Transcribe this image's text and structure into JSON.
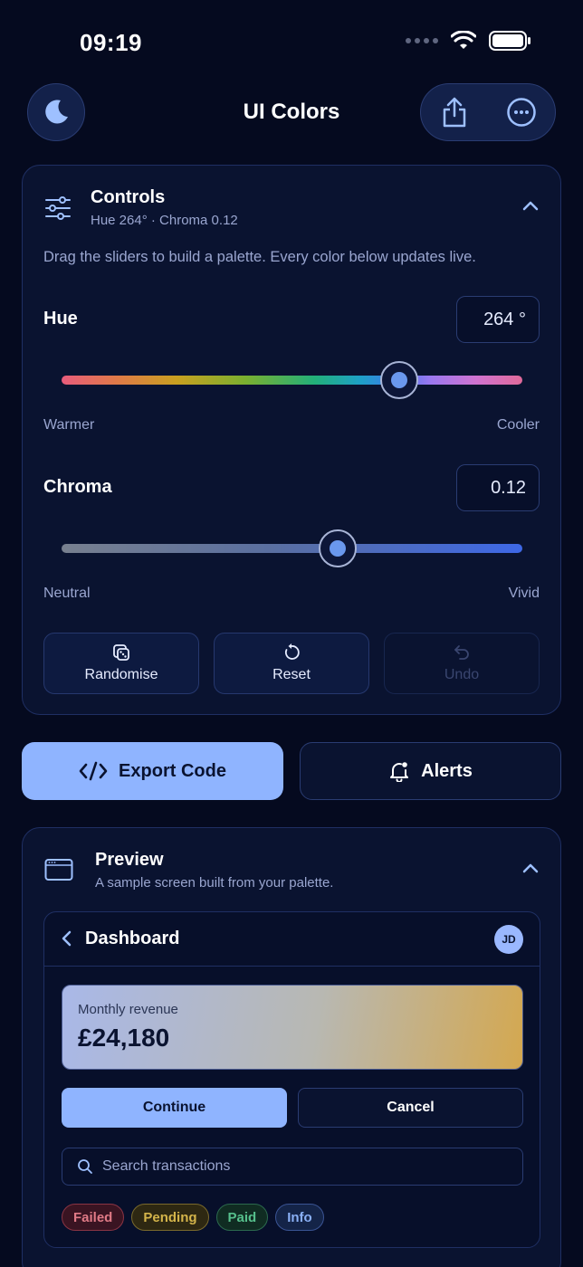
{
  "status_bar": {
    "time": "09:19"
  },
  "nav": {
    "title": "UI Colors"
  },
  "controls": {
    "title": "Controls",
    "subtitle": "Hue 264°  ·  Chroma 0.12",
    "hint": "Drag the sliders to build a palette. Every color below updates live.",
    "hue": {
      "label": "Hue",
      "value": "264 °",
      "numeric": 264,
      "min": 0,
      "max": 360,
      "min_label": "Warmer",
      "max_label": "Cooler"
    },
    "chroma": {
      "label": "Chroma",
      "value": "0.12",
      "numeric": 0.12,
      "min": 0,
      "max": 0.2,
      "min_label": "Neutral",
      "max_label": "Vivid"
    },
    "buttons": {
      "randomise": "Randomise",
      "reset": "Reset",
      "undo": "Undo"
    }
  },
  "actions": {
    "export": "Export Code",
    "alerts": "Alerts"
  },
  "preview": {
    "title": "Preview",
    "subtitle": "A sample screen built from your palette.",
    "dashboard": {
      "title": "Dashboard",
      "avatar": "JD",
      "revenue_label": "Monthly revenue",
      "revenue_value": "£24,180",
      "continue": "Continue",
      "cancel": "Cancel",
      "search_placeholder": "Search transactions",
      "chips": [
        "Failed",
        "Pending",
        "Paid",
        "Info"
      ]
    }
  },
  "colors": {
    "background": "#050a1f",
    "card": "#0a1330",
    "accent": "#8fb4ff",
    "thumb_fill": "#6a98ee"
  },
  "icons": {
    "theme": "moon-icon",
    "share": "share-icon",
    "more": "more-icon",
    "controls": "sliders-icon",
    "randomise": "dice-icon",
    "reset": "reset-icon",
    "undo": "undo-icon",
    "export": "code-icon",
    "alerts": "bell-icon",
    "preview": "window-icon"
  }
}
